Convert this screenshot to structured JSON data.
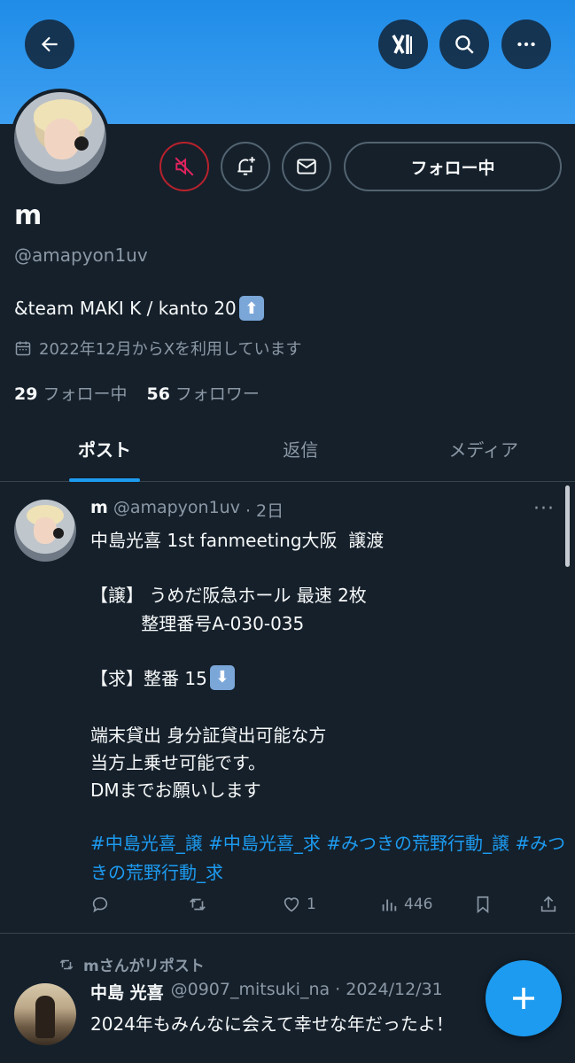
{
  "profile": {
    "name": "m",
    "handle": "@amapyon1uv",
    "bio_text": "&team MAKI K / kanto 20",
    "bio_emoji": "⬆",
    "joined": "2022年12月からXを利用しています",
    "following_count": "29",
    "following_label": "フォロー中",
    "followers_count": "56",
    "followers_label": "フォロワー",
    "follow_button_label": "フォロー中"
  },
  "tabs": [
    {
      "label": "ポスト",
      "active": true
    },
    {
      "label": "返信",
      "active": false
    },
    {
      "label": "メディア",
      "active": false
    }
  ],
  "tweet": {
    "name": "m",
    "handle": "@amapyon1uv",
    "time": "· 2日",
    "lines": [
      "中島光喜 1st fanmeeting大阪  譲渡",
      "【譲】 うめだ阪急ホール 最速 2枚",
      "         整理番号A-030-035",
      "【求】整番 15",
      "端末貸出 身分証貸出可能な方",
      "当方上乗せ可能です。",
      "DMまでお願いします"
    ],
    "want_emoji": "⬇",
    "hashtags": "#中島光喜_譲 #中島光喜_求 #みつきの荒野行動_譲 #みつきの荒野行動_求",
    "likes": "1",
    "views": "446"
  },
  "repost": {
    "label": "mさんがリポスト",
    "name": "中島 光喜",
    "handle_time": "@0907_mitsuki_na · 2024/12/31",
    "text": "2024年もみんなに会えて幸せな年だったよ！"
  }
}
